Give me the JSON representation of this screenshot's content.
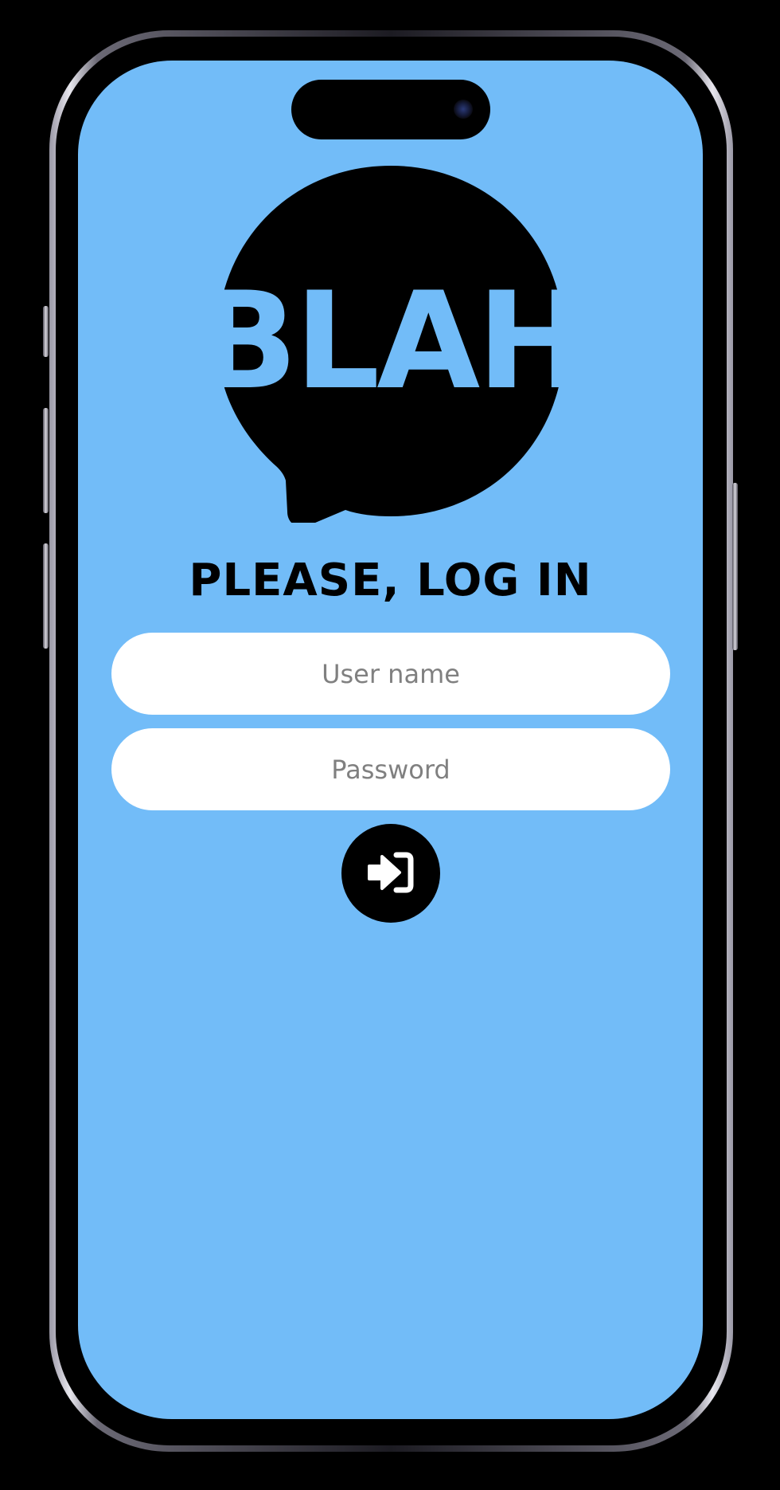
{
  "app": {
    "logo_text": "BLAH",
    "screen_bg_color": "#72bcf8"
  },
  "login": {
    "title": "PLEASE, LOG IN",
    "username_placeholder": "User name",
    "username_value": "",
    "password_placeholder": "Password",
    "password_value": "",
    "submit_icon": "sign-in-icon"
  }
}
